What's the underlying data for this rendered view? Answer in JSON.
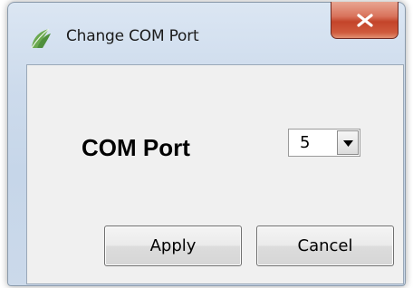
{
  "window": {
    "title": "Change COM Port"
  },
  "form": {
    "com_port_label": "COM Port",
    "com_port_value": "5"
  },
  "buttons": {
    "apply_label": "Apply",
    "cancel_label": "Cancel"
  },
  "icons": {
    "app": "app-leaf-icon",
    "close": "close-icon",
    "dropdown": "chevron-down-icon"
  },
  "colors": {
    "close_button": "#c3442a",
    "app_icon": "#4f8f3c",
    "client_background": "#f0f0f0"
  }
}
